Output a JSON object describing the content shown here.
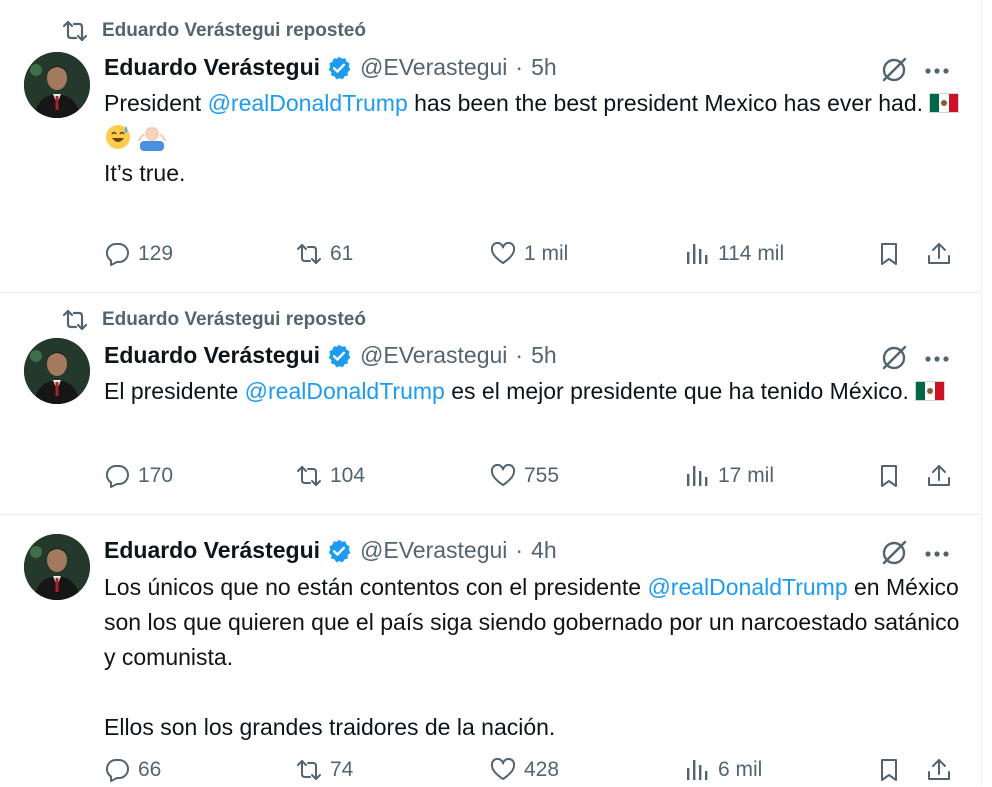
{
  "tweets": [
    {
      "repost_label": "Eduardo Verástegui reposteó",
      "author": "Eduardo Verástegui",
      "handle": "@EVerastegui",
      "separator": "·",
      "time": "5h",
      "text_before": "President ",
      "mention": "@realDonaldTrump",
      "text_after": " has been the best president Mexico has ever had.",
      "line2_emojis": [
        "grinning-sweat-emoji",
        "man-shrugging-emoji"
      ],
      "line3": "It’s true.",
      "replies": "129",
      "reposts": "61",
      "likes": "1 mil",
      "views": "114 mil"
    },
    {
      "repost_label": "Eduardo Verástegui reposteó",
      "author": "Eduardo Verástegui",
      "handle": "@EVerastegui",
      "separator": "·",
      "time": "5h",
      "text_before": "El presidente ",
      "mention": "@realDonaldTrump",
      "text_after": " es el mejor presidente que ha tenido México.",
      "replies": "170",
      "reposts": "104",
      "likes": "755",
      "views": "17 mil"
    },
    {
      "author": "Eduardo Verástegui",
      "handle": "@EVerastegui",
      "separator": "·",
      "time": "4h",
      "text_before": "Los únicos que no están contentos con el presidente ",
      "mention": "@realDonaldTrump",
      "text_after": " en México son los que quieren que el país siga siendo gobernado por un narcoestado satánico y comunista.",
      "paragraph2": "Ellos son los grandes traidores de la nación.",
      "replies": "66",
      "reposts": "74",
      "likes": "428",
      "views": "6 mil"
    }
  ],
  "colors": {
    "link": "#1d9bf0",
    "secondary_text": "#536471",
    "verified_badge": "#1d9bf0",
    "divider": "#e6ecf0"
  },
  "icons": [
    "repost-icon",
    "verified-badge-icon",
    "grok-icon",
    "more-icon",
    "reply-icon",
    "like-icon",
    "views-icon",
    "bookmark-icon",
    "share-icon",
    "mexico-flag-icon"
  ]
}
